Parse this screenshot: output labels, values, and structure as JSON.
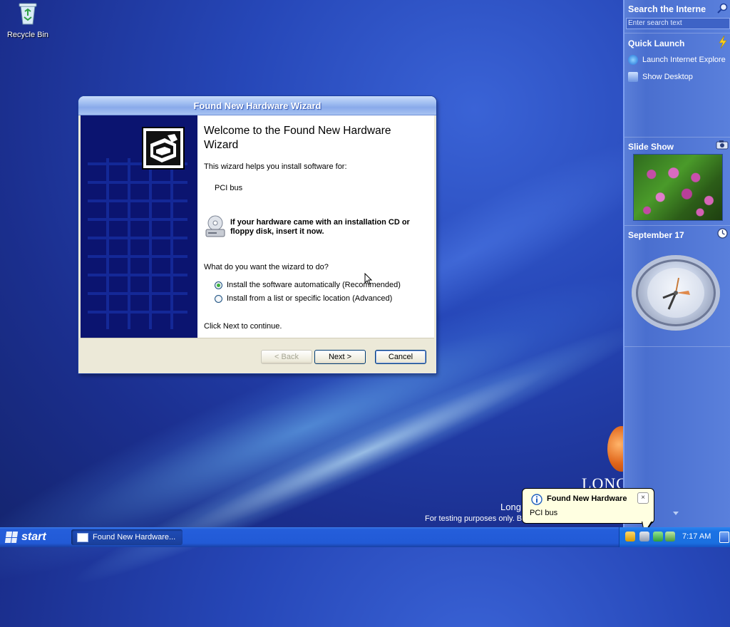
{
  "desktop": {
    "recycle_bin": "Recycle Bin",
    "brand_word": "LONG",
    "build_line1": "Long",
    "build_line2": "For testing purposes only. B"
  },
  "sidebar": {
    "search_title": "Search the Interne",
    "search_placeholder": "Enter search text",
    "quick_launch_title": "Quick Launch",
    "quick_launch_items": [
      {
        "label": "Launch Internet Explore",
        "icon": "internet-explorer-icon"
      },
      {
        "label": "Show Desktop",
        "icon": "show-desktop-icon"
      }
    ],
    "slideshow_title": "Slide Show",
    "clock_title": "September 17"
  },
  "wizard": {
    "title": "Found New Hardware Wizard",
    "heading": "Welcome to the Found New Hardware Wizard",
    "intro": "This wizard helps you install software for:",
    "device": "PCI bus",
    "cd_prompt": "If your hardware came with an installation CD or floppy disk, insert it now.",
    "question": "What do you want the wizard to do?",
    "options": [
      {
        "label": "Install the software automatically (Recommended)",
        "selected": true
      },
      {
        "label": "Install from a list or specific location (Advanced)",
        "selected": false
      }
    ],
    "continue_text": "Click Next to continue.",
    "buttons": {
      "back": "< Back",
      "next": "Next >",
      "cancel": "Cancel"
    }
  },
  "balloon": {
    "title": "Found New Hardware",
    "text": "PCI bus",
    "close": "×"
  },
  "taskbar": {
    "start_label": "start",
    "task_label": "Found New Hardware...",
    "time": "7:17 AM"
  },
  "colors": {
    "accent": "#245edb",
    "radio_selected": "#3cb13c",
    "wizard_banner": "#0b1470"
  }
}
